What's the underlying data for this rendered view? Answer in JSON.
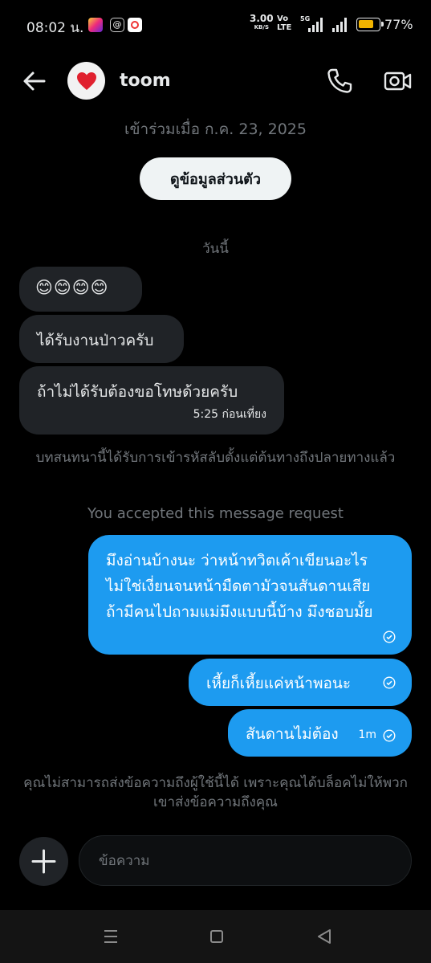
{
  "status_bar": {
    "time": "08:02 น.",
    "speed_value": "3.00",
    "speed_unit": "KB/S",
    "volte_top": "Vo",
    "volte_bottom": "LTE",
    "network": "5G",
    "battery_pct": "77%",
    "battery_level": 0.77,
    "icons": [
      "instagram-icon",
      "threads-icon",
      "screen-record-icon"
    ]
  },
  "header": {
    "username": "toom",
    "avatar_icon": "red-heart-icon",
    "actions": [
      "call-icon",
      "video-call-icon"
    ]
  },
  "conversation": {
    "joined_text": "เข้าร่วมเมื่อ ก.ค. 23, 2025",
    "profile_button": "ดูข้อมูลส่วนตัว",
    "day_label": "วันนี้",
    "incoming": [
      {
        "text": "😊😊😊😊"
      },
      {
        "text": "ได้รับงานป่าวครับ"
      },
      {
        "text": "ถ้าไม่ได้รับต้องขอโทษด้วยครับ",
        "time": "5:25 ก่อนเที่ยง"
      }
    ],
    "encryption_notice": "บทสนทนานี้ได้รับการเข้ารหัสลับตั้งแต่ต้นทางถึงปลายทางแล้ว",
    "accepted_notice": "You accepted this message request",
    "outgoing": [
      {
        "text": "มึงอ่านบ้างนะ ว่าหน้าทวิตเค้าเขียนอะไร ไม่ใช่เงี่ยนจนหน้ามืดตามัวจนสันดานเสีย ถ้ามีคนไปถามแม่มึงแบบนี้บ้าง มึงชอบมั้ย"
      },
      {
        "text": "เหี้ยก็เหี้ยแค่หน้าพอนะ"
      },
      {
        "text": "สันดานไม่ต้อง",
        "time": "1m"
      }
    ],
    "blocked_notice": "คุณไม่สามารถส่งข้อความถึงผู้ใช้นี้ได้ เพราะคุณได้บล็อคไม่ให้พวกเขาส่งข้อความถึงคุณ"
  },
  "composer": {
    "placeholder": "ข้อความ"
  },
  "colors": {
    "background": "#000000",
    "incoming_bubble": "#202327",
    "outgoing_bubble": "#1d9bf0",
    "muted_text": "#71767b"
  }
}
